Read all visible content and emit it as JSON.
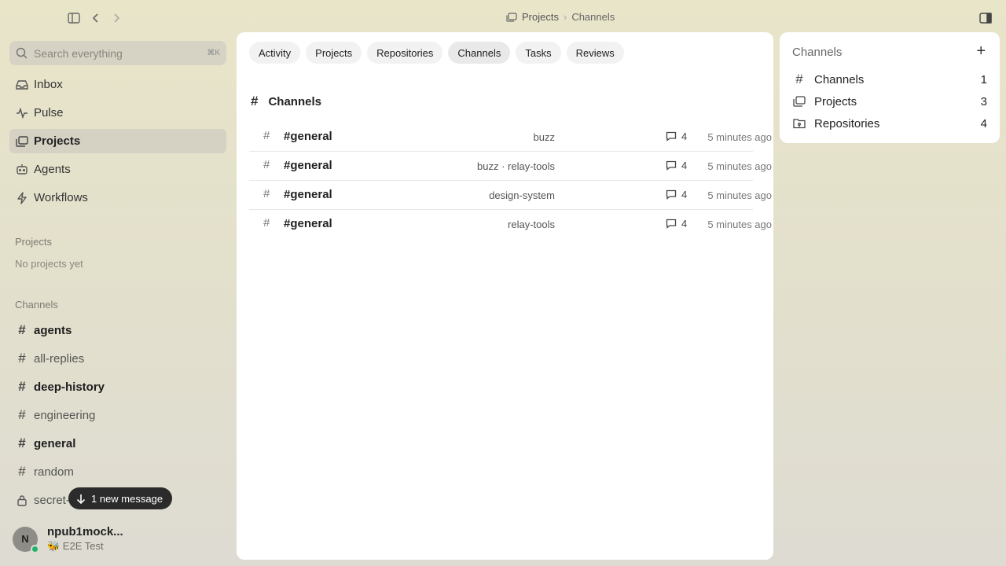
{
  "topbar": {
    "breadcrumb": {
      "parent": "Projects",
      "current": "Channels",
      "separator": "›"
    }
  },
  "sidebar": {
    "search": {
      "placeholder": "Search everything",
      "shortcut": "⌘K"
    },
    "nav": [
      {
        "label": "Inbox",
        "icon": "inbox-icon"
      },
      {
        "label": "Pulse",
        "icon": "pulse-icon"
      },
      {
        "label": "Projects",
        "icon": "projects-icon",
        "active": true
      },
      {
        "label": "Agents",
        "icon": "agents-icon"
      },
      {
        "label": "Workflows",
        "icon": "workflows-icon"
      }
    ],
    "projects_section": {
      "label": "Projects",
      "empty": "No projects yet"
    },
    "channels_section": {
      "label": "Channels",
      "items": [
        {
          "label": "agents",
          "bold": true
        },
        {
          "label": "all-replies",
          "bold": false
        },
        {
          "label": "deep-history",
          "bold": true
        },
        {
          "label": "engineering",
          "bold": false
        },
        {
          "label": "general",
          "bold": true
        },
        {
          "label": "random",
          "bold": false
        },
        {
          "label": "secret-",
          "bold": false,
          "locked": true
        }
      ]
    },
    "toast": {
      "label": "1 new message"
    },
    "user": {
      "initial": "N",
      "name": "npub1mock...",
      "status": "🐝 E2E Test"
    }
  },
  "main": {
    "tabs": [
      "Activity",
      "Projects",
      "Repositories",
      "Channels",
      "Tasks",
      "Reviews"
    ],
    "active_tab": "Channels",
    "heading": "Channels",
    "rows": [
      {
        "name": "#general",
        "project": "buzz",
        "count": "4",
        "time": "5 minutes ago"
      },
      {
        "name": "#general",
        "project": "buzz · relay-tools",
        "count": "4",
        "time": "5 minutes ago"
      },
      {
        "name": "#general",
        "project": "design-system",
        "count": "4",
        "time": "5 minutes ago"
      },
      {
        "name": "#general",
        "project": "relay-tools",
        "count": "4",
        "time": "5 minutes ago"
      }
    ]
  },
  "right_panel": {
    "title": "Channels",
    "items": [
      {
        "label": "Channels",
        "count": "1",
        "icon": "hash-icon"
      },
      {
        "label": "Projects",
        "count": "3",
        "icon": "projects-icon"
      },
      {
        "label": "Repositories",
        "count": "4",
        "icon": "repository-icon"
      }
    ]
  },
  "colors": {
    "accent_online": "#22b36b",
    "toast_bg": "#2b2b2b",
    "active_nav_bg": "#d5d2c3"
  }
}
